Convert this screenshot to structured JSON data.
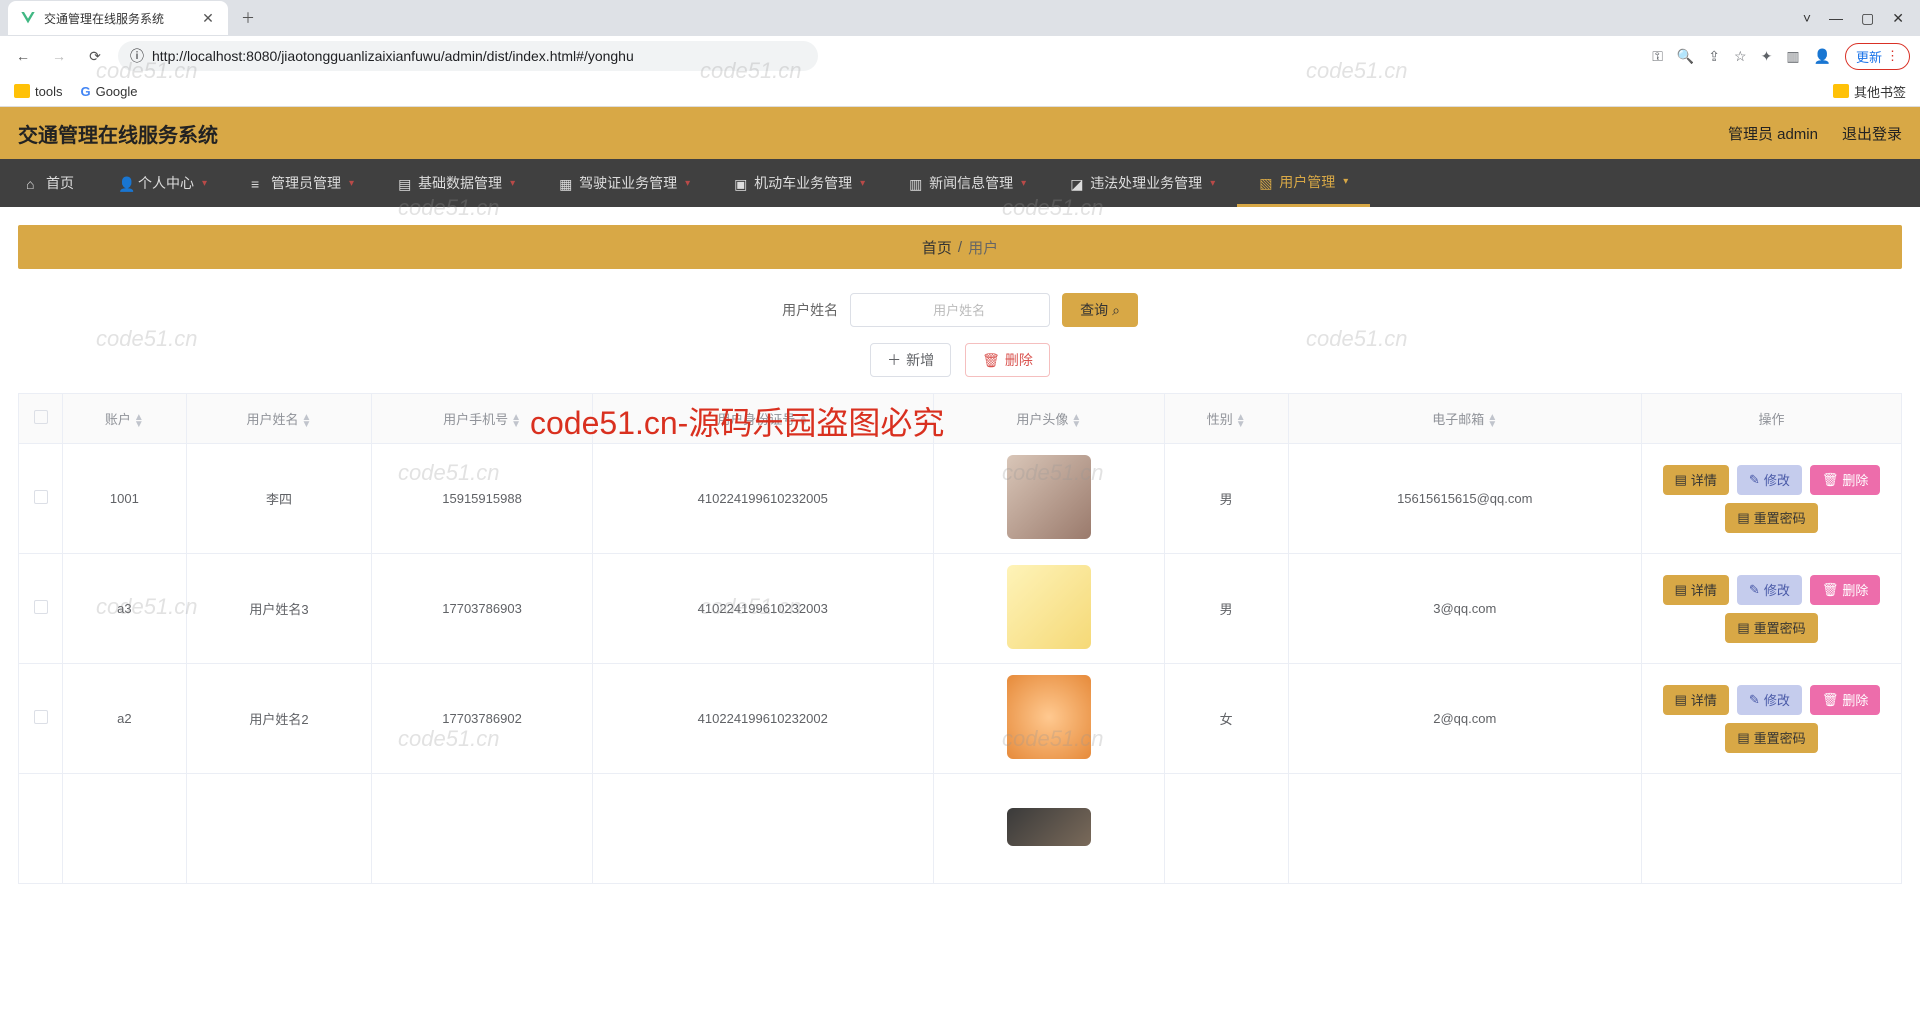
{
  "browser": {
    "tab_title": "交通管理在线服务系统",
    "url": "http://localhost:8080/jiaotongguanlizaixianfuwu/admin/dist/index.html#/yonghu",
    "update_label": "更新",
    "bookmarks": {
      "tools": "tools",
      "google": "Google",
      "other": "其他书签"
    }
  },
  "header": {
    "app_title": "交通管理在线服务系统",
    "user_label": "管理员 admin",
    "logout": "退出登录"
  },
  "nav": {
    "items": [
      "首页",
      "个人中心",
      "管理员管理",
      "基础数据管理",
      "驾驶证业务管理",
      "机动车业务管理",
      "新闻信息管理",
      "违法处理业务管理",
      "用户管理"
    ]
  },
  "breadcrumb": {
    "home": "首页",
    "sep": "/",
    "current": "用户"
  },
  "search": {
    "label": "用户姓名",
    "placeholder": "用户姓名",
    "button": "查询"
  },
  "actions": {
    "add": "新增",
    "delete": "删除"
  },
  "table": {
    "columns": [
      "账户",
      "用户姓名",
      "用户手机号",
      "用户身份证号",
      "用户头像",
      "性别",
      "电子邮箱",
      "操作"
    ],
    "ops": {
      "detail": "详情",
      "edit": "修改",
      "delete": "删除",
      "reset": "重置密码"
    },
    "rows": [
      {
        "account": "1001",
        "name": "李四",
        "phone": "15915915988",
        "idcard": "410224199610232005",
        "gender": "男",
        "email": "15615615615@qq.com"
      },
      {
        "account": "a3",
        "name": "用户姓名3",
        "phone": "17703786903",
        "idcard": "410224199610232003",
        "gender": "男",
        "email": "3@qq.com"
      },
      {
        "account": "a2",
        "name": "用户姓名2",
        "phone": "17703786902",
        "idcard": "410224199610232002",
        "gender": "女",
        "email": "2@qq.com"
      }
    ]
  },
  "watermarks": {
    "small": "code51.cn",
    "big": "code51.cn-源码乐园盗图必究"
  }
}
